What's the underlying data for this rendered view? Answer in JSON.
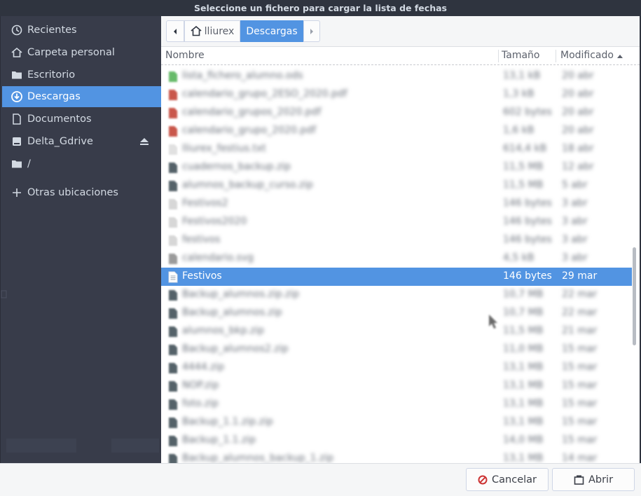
{
  "window": {
    "title": "Seleccione un fichero para cargar la lista de fechas"
  },
  "sidebar": {
    "items": [
      {
        "label": "Recientes",
        "icon": "clock-icon"
      },
      {
        "label": "Carpeta personal",
        "icon": "home-icon"
      },
      {
        "label": "Escritorio",
        "icon": "folder-icon"
      },
      {
        "label": "Descargas",
        "icon": "download-icon",
        "active": true
      },
      {
        "label": "Documentos",
        "icon": "document-icon"
      },
      {
        "label": "Delta_Gdrive",
        "icon": "drive-icon",
        "eject": true
      },
      {
        "label": "/",
        "icon": "folder-icon"
      }
    ],
    "other_locations": "Otras ubicaciones"
  },
  "pathbar": {
    "home_label": "lliurex",
    "current_label": "Descargas"
  },
  "columns": {
    "name": "Nombre",
    "size": "Tamaño",
    "modified": "Modificado"
  },
  "files": [
    {
      "name": "lista_fichero_alumno.ods",
      "size": "13,1 kB",
      "date": "20 abr"
    },
    {
      "name": "calendario_grupo_2ESO_2020.pdf",
      "size": "1,3 kB",
      "date": "20 abr"
    },
    {
      "name": "calendario_grupos_2020.pdf",
      "size": "602 bytes",
      "date": "20 abr"
    },
    {
      "name": "calendario_grupo_2020.pdf",
      "size": "1,6 kB",
      "date": "20 abr"
    },
    {
      "name": "lliurex_festius.txt",
      "size": "614,4 kB",
      "date": "18 abr"
    },
    {
      "name": "cuadernos_backup.zip",
      "size": "11,5 MB",
      "date": "12 abr"
    },
    {
      "name": "alumnos_backup_curso.zip",
      "size": "11,5 MB",
      "date": "5 abr"
    },
    {
      "name": "Festivos2",
      "size": "146 bytes",
      "date": "3 abr"
    },
    {
      "name": "Festivos2020",
      "size": "146 bytes",
      "date": "3 abr"
    },
    {
      "name": "festivos",
      "size": "146 bytes",
      "date": "3 abr"
    },
    {
      "name": "calendario.svg",
      "size": "4,5 kB",
      "date": "3 abr"
    },
    {
      "name": "Festivos",
      "size": "146 bytes",
      "date": "29 mar",
      "selected": true
    },
    {
      "name": "Backup_alumnos.zip.zip",
      "size": "10,7 MB",
      "date": "22 mar"
    },
    {
      "name": "Backup_alumnos.zip",
      "size": "10,7 MB",
      "date": "22 mar"
    },
    {
      "name": "alumnos_bkp.zip",
      "size": "11,5 MB",
      "date": "21 mar"
    },
    {
      "name": "Backup_alumnos2.zip",
      "size": "11,0 MB",
      "date": "15 mar"
    },
    {
      "name": "4444.zip",
      "size": "13,1 MB",
      "date": "15 mar"
    },
    {
      "name": "NOP.zip",
      "size": "13,1 MB",
      "date": "15 mar"
    },
    {
      "name": "foto.zip",
      "size": "13,1 MB",
      "date": "15 mar"
    },
    {
      "name": "Backup_1.1.zip.zip",
      "size": "13,1 MB",
      "date": "15 mar"
    },
    {
      "name": "Backup_1.1.zip",
      "size": "14,0 MB",
      "date": "15 mar"
    },
    {
      "name": "Backup_alumnos_backup_1.zip",
      "size": "13,1 MB",
      "date": "14 mar"
    }
  ],
  "buttons": {
    "cancel": "Cancelar",
    "open": "Abrir"
  },
  "colors": {
    "accent": "#5294e2",
    "sidebar_bg": "#383c4a",
    "titlebar_bg": "#2f343f"
  }
}
